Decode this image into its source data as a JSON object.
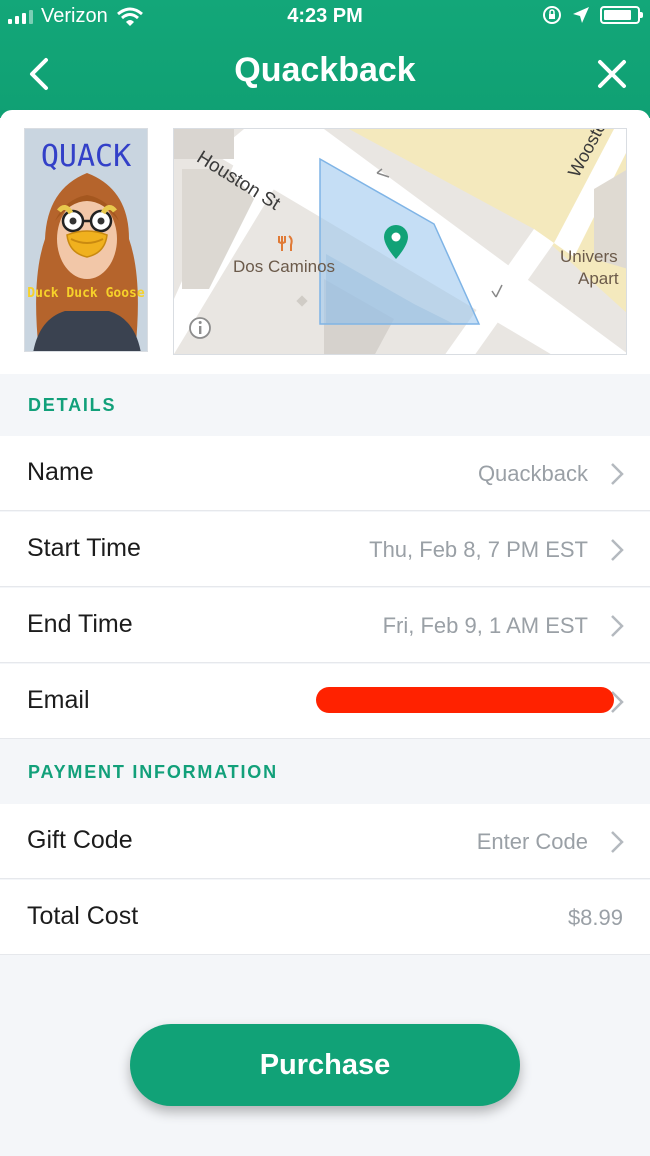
{
  "status_bar": {
    "carrier": "Verizon",
    "time": "4:23 PM"
  },
  "nav": {
    "title": "Quackback"
  },
  "preview": {
    "snap_text_top": "QUACK",
    "snap_text_caption": "Duck Duck Goose",
    "map_labels": {
      "street_1": "Houston St",
      "street_2": "Wooster",
      "place": "Dos Caminos",
      "building_line1": "Univers",
      "building_line2": "Apart"
    }
  },
  "details": {
    "header": "DETAILS",
    "rows": [
      {
        "label": "Name",
        "value": "Quackback"
      },
      {
        "label": "Start Time",
        "value": "Thu, Feb 8, 7 PM EST"
      },
      {
        "label": "End Time",
        "value": "Fri, Feb 9, 1 AM EST"
      },
      {
        "label": "Email",
        "value": ""
      }
    ]
  },
  "payment": {
    "header": "PAYMENT INFORMATION",
    "gift_code": {
      "label": "Gift Code",
      "placeholder": "Enter Code"
    },
    "total_cost": {
      "label": "Total Cost",
      "value": "$8.99"
    }
  },
  "actions": {
    "purchase_label": "Purchase"
  },
  "colors": {
    "brand_green": "#12a57a",
    "redaction": "#ff2200"
  },
  "battery_level": 0.85
}
